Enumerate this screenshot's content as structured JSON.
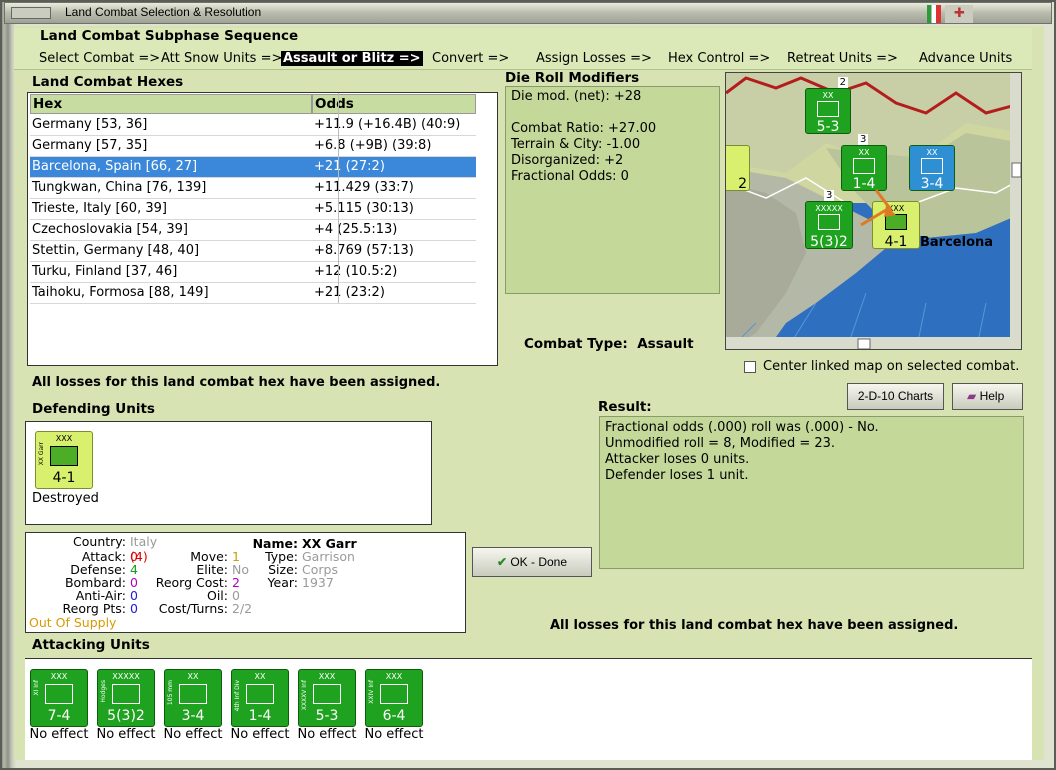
{
  "window": {
    "title": "Land Combat Selection & Resolution"
  },
  "subphase": {
    "heading": "Land Combat Subphase Sequence",
    "steps": [
      "Select Combat =>",
      "Att Snow Units =>",
      "Assault or Blitz =>",
      "Convert =>",
      "Assign Losses =>",
      "Hex Control =>",
      "Retreat Units =>",
      "Advance Units"
    ],
    "selected_index": 2
  },
  "hexes": {
    "heading": "Land Combat Hexes",
    "col_hex": "Hex",
    "col_odds": "Odds",
    "rows": [
      {
        "hex": "Germany [53, 36]",
        "odds": "+11.9 (+16.4B) (40:9)"
      },
      {
        "hex": "Germany [57, 35]",
        "odds": "+6.8 (+9B) (39:8)"
      },
      {
        "hex": "Barcelona, Spain [66, 27]",
        "odds": "+21 (27:2)"
      },
      {
        "hex": "Tungkwan, China [76, 139]",
        "odds": "+11.429 (33:7)"
      },
      {
        "hex": "Trieste, Italy [60, 39]",
        "odds": "+5.115 (30:13)"
      },
      {
        "hex": "Czechoslovakia [54, 39]",
        "odds": "+4 (25.5:13)"
      },
      {
        "hex": "Stettin, Germany [48, 40]",
        "odds": "+8.769 (57:13)"
      },
      {
        "hex": "Turku, Finland [37, 46]",
        "odds": "+12 (10.5:2)"
      },
      {
        "hex": "Taihoku, Formosa [88, 149]",
        "odds": "+21 (23:2)"
      }
    ],
    "selected_index": 2
  },
  "drm": {
    "heading": "Die Roll Modifiers",
    "lines": [
      "Die mod. (net): +28",
      "",
      "Combat Ratio: +27.00",
      "Terrain & City: -1.00",
      "Disorganized: +2",
      "Fractional Odds: 0"
    ]
  },
  "combat_type": {
    "label": "Combat Type:",
    "value": "Assault"
  },
  "map": {
    "city_label": "Barcelona",
    "center_label": "Center linked map on selected combat.",
    "units": [
      {
        "size": "XX",
        "value": "5-3",
        "stack": "2"
      },
      {
        "size": "XX",
        "value": "1-4",
        "stack": "3"
      },
      {
        "size": "XX",
        "value": "3-4"
      },
      {
        "size": "XXXXX",
        "value": "5(3)2",
        "stack": "3"
      },
      {
        "size": "XXX",
        "value": "4-1"
      },
      {
        "value": "2"
      }
    ]
  },
  "buttons": {
    "charts": "2-D-10 Charts",
    "help": "Help",
    "ok": "OK - Done"
  },
  "status_msg": "All losses for this land combat hex have been assigned.",
  "status_msg2": "All losses for this land combat hex have been assigned.",
  "defending": {
    "heading": "Defending Units",
    "units": [
      {
        "name": "XX Garr",
        "size": "XXX",
        "value": "4-1",
        "status": "Destroyed"
      }
    ]
  },
  "result": {
    "heading": "Result:",
    "lines": [
      "Fractional odds (.000) roll was (.000)  - No.",
      "Unmodified roll = 8, Modified = 23.",
      "Attacker loses 0 units.",
      "Defender loses 1 unit."
    ]
  },
  "details": {
    "country_l": "Country:",
    "country": "Italy",
    "attack_l": "Attack:",
    "attack": "0",
    "attack2": "(4)",
    "defense_l": "Defense:",
    "defense": "4",
    "bombard_l": "Bombard:",
    "bombard": "0",
    "antiair_l": "Anti-Air:",
    "antiair": "0",
    "reorg_l": "Reorg Pts:",
    "reorg": "0",
    "supply": "Out Of Supply",
    "move_l": "Move:",
    "move": "1",
    "elite_l": "Elite:",
    "elite": "No",
    "reorgcost_l": "Reorg Cost:",
    "reorgcost": "2",
    "oil_l": "Oil:",
    "oil": "0",
    "cost_l": "Cost/Turns:",
    "cost": "2/2",
    "name_l": "Name:",
    "name": "XX Garr",
    "type_l": "Type:",
    "type": "Garrison",
    "size_l": "Size:",
    "size": "Corps",
    "year_l": "Year:",
    "year": "1937"
  },
  "attacking": {
    "heading": "Attacking Units",
    "units": [
      {
        "name": "XI Inf",
        "size": "XXX",
        "value": "7-4",
        "status": "No effect"
      },
      {
        "name": "Hodges",
        "size": "XXXXX",
        "value": "5(3)2",
        "status": "No effect"
      },
      {
        "name": "105 mm",
        "size": "XX",
        "value": "3-4",
        "status": "No effect"
      },
      {
        "name": "4th Inf Div",
        "size": "XX",
        "value": "1-4",
        "status": "No effect"
      },
      {
        "name": "XXXXV Inf",
        "size": "XXX",
        "value": "5-3",
        "status": "No effect"
      },
      {
        "name": "XXIV Inf",
        "size": "XXX",
        "value": "6-4",
        "status": "No effect"
      }
    ]
  }
}
